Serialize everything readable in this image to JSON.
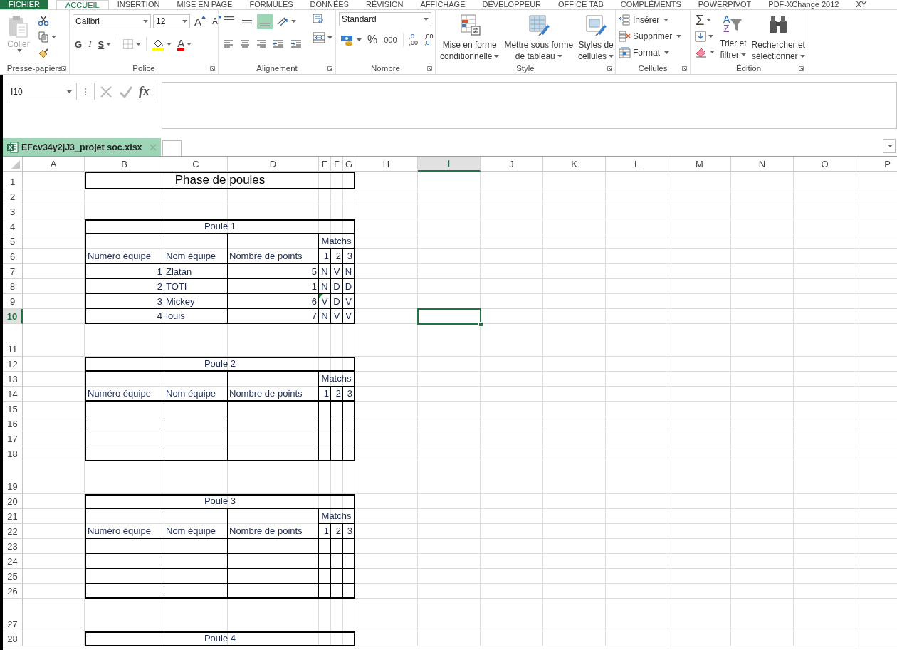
{
  "ribbon_tabs": [
    {
      "label": "FICHIER",
      "kind": "file",
      "selected": false
    },
    {
      "label": "ACCUEIL",
      "kind": "tab",
      "selected": true
    },
    {
      "label": "INSERTION",
      "kind": "tab",
      "selected": false
    },
    {
      "label": "MISE EN PAGE",
      "kind": "tab",
      "selected": false
    },
    {
      "label": "FORMULES",
      "kind": "tab",
      "selected": false
    },
    {
      "label": "DONNÉES",
      "kind": "tab",
      "selected": false
    },
    {
      "label": "RÉVISION",
      "kind": "tab",
      "selected": false
    },
    {
      "label": "AFFICHAGE",
      "kind": "tab",
      "selected": false
    },
    {
      "label": "DÉVELOPPEUR",
      "kind": "tab",
      "selected": false
    },
    {
      "label": "OFFICE TAB",
      "kind": "tab",
      "selected": false
    },
    {
      "label": "COMPLÉMENTS",
      "kind": "tab",
      "selected": false
    },
    {
      "label": "POWERPIVOT",
      "kind": "tab",
      "selected": false
    },
    {
      "label": "PDF-XChange 2012",
      "kind": "tab",
      "selected": false
    },
    {
      "label": "XY",
      "kind": "tab",
      "selected": false
    }
  ],
  "clipboard": {
    "label": "Presse-papiers",
    "paste": {
      "label": "Coller",
      "disabled": true
    }
  },
  "font": {
    "label": "Police",
    "font_name": "Calibri",
    "font_size": "12",
    "grow": "A",
    "shrink": "A",
    "bold": "G",
    "italic": "I",
    "underline": "S",
    "font_color": "A"
  },
  "alignment": {
    "label": "Alignement",
    "vertical_align": [
      {
        "selected": false
      },
      {
        "selected": false
      },
      {
        "selected": true
      }
    ]
  },
  "number": {
    "label": "Nombre",
    "format": "Standard",
    "percent": "%",
    "thousands": "000",
    "add_decimal": [
      ",0",
      ",00"
    ],
    "remove_decimal": [
      ",00",
      ",0"
    ]
  },
  "style": {
    "label": "Style",
    "buttons": [
      {
        "kind": "conditional",
        "lines": [
          "Mise en forme",
          "conditionnelle"
        ]
      },
      {
        "kind": "table",
        "lines": [
          "Mettre sous forme",
          "de tableau"
        ]
      },
      {
        "kind": "cellstyle",
        "lines": [
          "Styles de",
          "cellules"
        ]
      }
    ]
  },
  "cells": {
    "label": "Cellules",
    "buttons": [
      {
        "kind": "insert",
        "label": "Insérer"
      },
      {
        "kind": "delete",
        "label": "Supprimer"
      },
      {
        "kind": "format",
        "label": "Format"
      }
    ]
  },
  "editing": {
    "label": "Édition",
    "sum": "Σ",
    "sort": {
      "glyphs": [
        "A",
        "Z"
      ],
      "lines": [
        "Trier et",
        "filtrer"
      ]
    },
    "find": {
      "lines": [
        "Rechercher et",
        "sélectionner"
      ]
    }
  },
  "formula_bar": {
    "name_box": "I10",
    "function_label": "fx"
  },
  "document_tab": {
    "label": "EFcv34y2jJ3_projet soc.xlsx",
    "selected": true
  },
  "sheet": {
    "columns": [
      {
        "label": "A",
        "selected": false
      },
      {
        "label": "B",
        "selected": false
      },
      {
        "label": "C",
        "selected": false
      },
      {
        "label": "D",
        "selected": false
      },
      {
        "label": "E",
        "selected": false
      },
      {
        "label": "F",
        "selected": false
      },
      {
        "label": "G",
        "selected": false
      },
      {
        "label": "H",
        "selected": false
      },
      {
        "label": "I",
        "selected": true
      },
      {
        "label": "J",
        "selected": false
      },
      {
        "label": "K",
        "selected": false
      },
      {
        "label": "L",
        "selected": false
      },
      {
        "label": "M",
        "selected": false
      },
      {
        "label": "N",
        "selected": false
      },
      {
        "label": "O",
        "selected": false
      },
      {
        "label": "P",
        "selected": false
      }
    ],
    "rows": [
      {
        "label": "1",
        "selected": false
      },
      {
        "label": "2",
        "selected": false
      },
      {
        "label": "3",
        "selected": false
      },
      {
        "label": "4",
        "selected": false
      },
      {
        "label": "5",
        "selected": false
      },
      {
        "label": "6",
        "selected": false
      },
      {
        "label": "7",
        "selected": false
      },
      {
        "label": "8",
        "selected": false
      },
      {
        "label": "9",
        "selected": false
      },
      {
        "label": "10",
        "selected": true
      },
      {
        "label": "11",
        "selected": false
      },
      {
        "label": "12",
        "selected": false
      },
      {
        "label": "13",
        "selected": false
      },
      {
        "label": "14",
        "selected": false
      },
      {
        "label": "15",
        "selected": false
      },
      {
        "label": "16",
        "selected": false
      },
      {
        "label": "17",
        "selected": false
      },
      {
        "label": "18",
        "selected": false
      },
      {
        "label": "19",
        "selected": false
      },
      {
        "label": "20",
        "selected": false
      },
      {
        "label": "21",
        "selected": false
      },
      {
        "label": "22",
        "selected": false
      },
      {
        "label": "23",
        "selected": false
      },
      {
        "label": "24",
        "selected": false
      },
      {
        "label": "25",
        "selected": false
      },
      {
        "label": "26",
        "selected": false
      },
      {
        "label": "27",
        "selected": false
      },
      {
        "label": "28",
        "selected": false
      }
    ],
    "title": "Phase de poules",
    "pools": [
      {
        "title": "Poule 1",
        "headers": [
          "Numéro équipe",
          "Nom équipe",
          "Nombre de points"
        ],
        "matches_label": "Matchs",
        "match_numbers": [
          "1",
          "2",
          "3"
        ],
        "teams": [
          {
            "number": "1",
            "name": "Zlatan",
            "points": "5",
            "results": [
              {
                "value": "N",
                "flagged": false
              },
              {
                "value": "V",
                "flagged": false
              },
              {
                "value": "N",
                "flagged": false
              }
            ]
          },
          {
            "number": "2",
            "name": "TOTI",
            "points": "1",
            "results": [
              {
                "value": "N",
                "flagged": false
              },
              {
                "value": "D",
                "flagged": false
              },
              {
                "value": "D",
                "flagged": false
              }
            ]
          },
          {
            "number": "3",
            "name": "Mickey",
            "points": "6",
            "results": [
              {
                "value": "V",
                "flagged": true
              },
              {
                "value": "D",
                "flagged": false
              },
              {
                "value": "V",
                "flagged": false
              }
            ]
          },
          {
            "number": "4",
            "name": "louis",
            "points": "7",
            "results": [
              {
                "value": "N",
                "flagged": false
              },
              {
                "value": "V",
                "flagged": false
              },
              {
                "value": "V",
                "flagged": false
              }
            ]
          }
        ]
      },
      {
        "title": "Poule 2",
        "headers": [
          "Numéro équipe",
          "Nom équipe",
          "Nombre de points"
        ],
        "matches_label": "Matchs",
        "match_numbers": [
          "1",
          "2",
          "3"
        ]
      },
      {
        "title": "Poule 3",
        "headers": [
          "Numéro équipe",
          "Nom équipe",
          "Nombre de points"
        ],
        "matches_label": "Matchs",
        "match_numbers": [
          "1",
          "2",
          "3"
        ]
      },
      {
        "title": "Poule 4"
      }
    ]
  }
}
